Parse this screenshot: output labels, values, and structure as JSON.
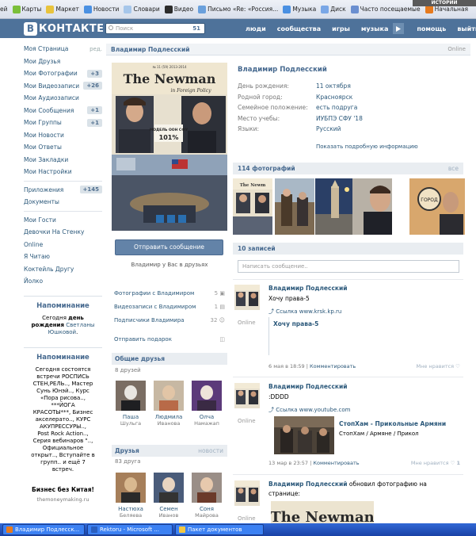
{
  "bookmarks": [
    {
      "label": "ей",
      "color": "#ffffff"
    },
    {
      "label": "Карты",
      "color": "#7bbf3a"
    },
    {
      "label": "Маркет",
      "color": "#e8c33c"
    },
    {
      "label": "Новости",
      "color": "#4a90e2"
    },
    {
      "label": "Словари",
      "color": "#a6c6ea"
    },
    {
      "label": "Видео",
      "color": "#2c2c2c"
    },
    {
      "label": "Письмо «Re: «Россия...",
      "color": "#6aa0dc"
    },
    {
      "label": "Музыка",
      "color": "#4a90e2"
    },
    {
      "label": "Диск",
      "color": "#7aa7e6"
    },
    {
      "label": "Часто посещаемые",
      "color": "#6b8fd0"
    },
    {
      "label": "Начальная",
      "color": "#e67a1e"
    }
  ],
  "bookmark_banner": "ИСТОРИЙ",
  "header": {
    "logo_letter": "В",
    "logo_text": "КОНТАКТЕ",
    "search_placeholder": "Поиск",
    "search_count": "51",
    "nav": [
      "люди",
      "сообщества",
      "игры",
      "музыка",
      "помощь",
      "выйти"
    ]
  },
  "menu": {
    "edit": "ред.",
    "items": [
      {
        "label": "Моя Страница",
        "badge": ""
      },
      {
        "label": "Мои Друзья",
        "badge": ""
      },
      {
        "label": "Мои Фотографии",
        "badge": "+3"
      },
      {
        "label": "Мои Видеозаписи",
        "badge": "+26"
      },
      {
        "label": "Мои Аудиозаписи",
        "badge": ""
      },
      {
        "label": "Мои Сообщения",
        "badge": "+1"
      },
      {
        "label": "Мои Группы",
        "badge": "+1"
      },
      {
        "label": "Мои Новости",
        "badge": ""
      },
      {
        "label": "Мои Ответы",
        "badge": ""
      },
      {
        "label": "Мои Закладки",
        "badge": ""
      },
      {
        "label": "Мои Настройки",
        "badge": ""
      }
    ],
    "apps": [
      {
        "label": "Приложения",
        "badge": "+145"
      },
      {
        "label": "Документы",
        "badge": ""
      }
    ],
    "extras": [
      "Мои Гости",
      "Девочки На Стенку",
      "Online",
      "Я Читаю",
      "Коктейль Другу",
      "Йолко"
    ]
  },
  "reminder1": {
    "title": "Напоминание",
    "pre": "Сегодня ",
    "bold": "день рождения",
    "link": " Светланы Юшковой",
    "post": "."
  },
  "reminder2": {
    "title": "Напоминание",
    "lines": [
      "Сегодня состоятся",
      "встречи РОСПИСЬ",
      "СТЕН,РЕЛЬ.., Мастер",
      "Сунь Юнэй.., Курс",
      "«Пора рисова..,",
      "***ЙОГА",
      "КРАСОТЫ***, Бизнес",
      "акселерато.., КУРС",
      "АКУПРЕССУРЫ..,",
      "Post Rock Action..,",
      "Серия вебинаров \"..,",
      "Официальное",
      "открыт.., Вступайте в",
      "групп.. и ещё 7",
      "встреч."
    ]
  },
  "ad": {
    "title": "Бизнес без Китая!",
    "site": "themoneymaking.ru"
  },
  "profile": {
    "name": "Владимир Подлесский",
    "status": "Online",
    "poster": {
      "title": "The Newman",
      "subtitle": "in Foreign Policy",
      "tag": "№ 11 (59) 2013-2014",
      "note": "МОДЕЛЬ ООН СФУ",
      "pct": "101%"
    },
    "info": [
      {
        "k": "День рождения:",
        "v": "11 октября"
      },
      {
        "k": "Родной город:",
        "v": "Красноярск"
      },
      {
        "k": "Семейное положение:",
        "v": "есть подруга"
      },
      {
        "k": "Место учебы:",
        "v": "ИУБПЭ СФУ '18"
      },
      {
        "k": "Языки:",
        "v": "Русский"
      }
    ],
    "more": "Показать подробную информацию",
    "send": "Отправить сообщение",
    "in_friends": "Владимир у Вас в друзьях",
    "links": [
      {
        "label": "Фотографии с Владимиром",
        "count": "5"
      },
      {
        "label": "Видеозаписи с Владимиром",
        "count": "1"
      },
      {
        "label": "Подписчики Владимира",
        "count": "32"
      }
    ],
    "gift": "Отправить подарок"
  },
  "common": {
    "title": "Общие друзья",
    "count": "8 друзей",
    "people": [
      {
        "f": "Паша",
        "l": "Шульга"
      },
      {
        "f": "Людмила",
        "l": "Иванова"
      },
      {
        "f": "Олча",
        "l": "Намажап"
      }
    ]
  },
  "friends": {
    "title": "Друзья",
    "news": "новости",
    "count": "83 друга",
    "people": [
      {
        "f": "Настюха",
        "l": "Беляева"
      },
      {
        "f": "Семен",
        "l": "Иванов"
      },
      {
        "f": "Соня",
        "l": "Майрова"
      }
    ]
  },
  "photos": {
    "title": "114 фотографий",
    "all": "все"
  },
  "wall": {
    "title": "10 записей",
    "placeholder": "Написать сообщение.."
  },
  "posts": [
    {
      "author": "Владимир Подлесский",
      "text": "Хочу права-5",
      "link": "Ссылка www.krsk.kp.ru",
      "link_title": "Хочу права-5",
      "time": "6 мая в 18:59",
      "comment": "Комментировать",
      "like": "Мне нравится",
      "online": "Online"
    },
    {
      "author": "Владимир Подлесский",
      "text": ":DDDD",
      "link": "Ссылка www.youtube.com",
      "video_title": "СтопХам - Прикольные Армяни",
      "video_sub": "СтопХам / Армяне / Прикол",
      "time": "13 мар в 23:57",
      "comment": "Комментировать",
      "like": "Мне нравится",
      "likes": "1",
      "online": "Online"
    },
    {
      "author": "Владимир Подлесский",
      "action": " обновил фотографию на",
      "action2": "странице:",
      "poster": "The Newman",
      "online": "Online"
    }
  ],
  "taskbar": [
    {
      "label": "Владимир Подлесск...",
      "color": "#e67a1e"
    },
    {
      "label": "Rektoru - Microsoft ...",
      "color": "#2b5fbf"
    },
    {
      "label": "Пакет документов",
      "color": "#f2c744"
    }
  ]
}
